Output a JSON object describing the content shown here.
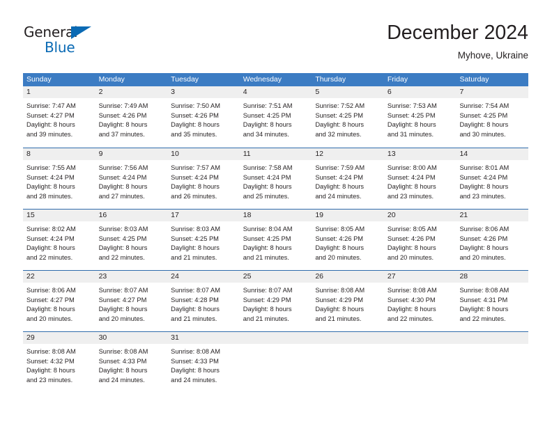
{
  "brand": {
    "name_part1": "General",
    "name_part2": "Blue",
    "triangle_icon": "triangle-icon",
    "color_dark": "#231f20",
    "color_blue": "#0a6ab4"
  },
  "header": {
    "title": "December 2024",
    "subtitle": "Myhove, Ukraine"
  },
  "colors": {
    "header_blue": "#3c7cc3",
    "row_divider_blue": "#2e6bab",
    "day_band_gray": "#efefef",
    "text": "#231f20"
  },
  "calendar": {
    "day_headers": [
      "Sunday",
      "Monday",
      "Tuesday",
      "Wednesday",
      "Thursday",
      "Friday",
      "Saturday"
    ],
    "weeks": [
      [
        {
          "day": "1",
          "sunrise": "Sunrise: 7:47 AM",
          "sunset": "Sunset: 4:27 PM",
          "daylight1": "Daylight: 8 hours",
          "daylight2": "and 39 minutes."
        },
        {
          "day": "2",
          "sunrise": "Sunrise: 7:49 AM",
          "sunset": "Sunset: 4:26 PM",
          "daylight1": "Daylight: 8 hours",
          "daylight2": "and 37 minutes."
        },
        {
          "day": "3",
          "sunrise": "Sunrise: 7:50 AM",
          "sunset": "Sunset: 4:26 PM",
          "daylight1": "Daylight: 8 hours",
          "daylight2": "and 35 minutes."
        },
        {
          "day": "4",
          "sunrise": "Sunrise: 7:51 AM",
          "sunset": "Sunset: 4:25 PM",
          "daylight1": "Daylight: 8 hours",
          "daylight2": "and 34 minutes."
        },
        {
          "day": "5",
          "sunrise": "Sunrise: 7:52 AM",
          "sunset": "Sunset: 4:25 PM",
          "daylight1": "Daylight: 8 hours",
          "daylight2": "and 32 minutes."
        },
        {
          "day": "6",
          "sunrise": "Sunrise: 7:53 AM",
          "sunset": "Sunset: 4:25 PM",
          "daylight1": "Daylight: 8 hours",
          "daylight2": "and 31 minutes."
        },
        {
          "day": "7",
          "sunrise": "Sunrise: 7:54 AM",
          "sunset": "Sunset: 4:25 PM",
          "daylight1": "Daylight: 8 hours",
          "daylight2": "and 30 minutes."
        }
      ],
      [
        {
          "day": "8",
          "sunrise": "Sunrise: 7:55 AM",
          "sunset": "Sunset: 4:24 PM",
          "daylight1": "Daylight: 8 hours",
          "daylight2": "and 28 minutes."
        },
        {
          "day": "9",
          "sunrise": "Sunrise: 7:56 AM",
          "sunset": "Sunset: 4:24 PM",
          "daylight1": "Daylight: 8 hours",
          "daylight2": "and 27 minutes."
        },
        {
          "day": "10",
          "sunrise": "Sunrise: 7:57 AM",
          "sunset": "Sunset: 4:24 PM",
          "daylight1": "Daylight: 8 hours",
          "daylight2": "and 26 minutes."
        },
        {
          "day": "11",
          "sunrise": "Sunrise: 7:58 AM",
          "sunset": "Sunset: 4:24 PM",
          "daylight1": "Daylight: 8 hours",
          "daylight2": "and 25 minutes."
        },
        {
          "day": "12",
          "sunrise": "Sunrise: 7:59 AM",
          "sunset": "Sunset: 4:24 PM",
          "daylight1": "Daylight: 8 hours",
          "daylight2": "and 24 minutes."
        },
        {
          "day": "13",
          "sunrise": "Sunrise: 8:00 AM",
          "sunset": "Sunset: 4:24 PM",
          "daylight1": "Daylight: 8 hours",
          "daylight2": "and 23 minutes."
        },
        {
          "day": "14",
          "sunrise": "Sunrise: 8:01 AM",
          "sunset": "Sunset: 4:24 PM",
          "daylight1": "Daylight: 8 hours",
          "daylight2": "and 23 minutes."
        }
      ],
      [
        {
          "day": "15",
          "sunrise": "Sunrise: 8:02 AM",
          "sunset": "Sunset: 4:24 PM",
          "daylight1": "Daylight: 8 hours",
          "daylight2": "and 22 minutes."
        },
        {
          "day": "16",
          "sunrise": "Sunrise: 8:03 AM",
          "sunset": "Sunset: 4:25 PM",
          "daylight1": "Daylight: 8 hours",
          "daylight2": "and 22 minutes."
        },
        {
          "day": "17",
          "sunrise": "Sunrise: 8:03 AM",
          "sunset": "Sunset: 4:25 PM",
          "daylight1": "Daylight: 8 hours",
          "daylight2": "and 21 minutes."
        },
        {
          "day": "18",
          "sunrise": "Sunrise: 8:04 AM",
          "sunset": "Sunset: 4:25 PM",
          "daylight1": "Daylight: 8 hours",
          "daylight2": "and 21 minutes."
        },
        {
          "day": "19",
          "sunrise": "Sunrise: 8:05 AM",
          "sunset": "Sunset: 4:26 PM",
          "daylight1": "Daylight: 8 hours",
          "daylight2": "and 20 minutes."
        },
        {
          "day": "20",
          "sunrise": "Sunrise: 8:05 AM",
          "sunset": "Sunset: 4:26 PM",
          "daylight1": "Daylight: 8 hours",
          "daylight2": "and 20 minutes."
        },
        {
          "day": "21",
          "sunrise": "Sunrise: 8:06 AM",
          "sunset": "Sunset: 4:26 PM",
          "daylight1": "Daylight: 8 hours",
          "daylight2": "and 20 minutes."
        }
      ],
      [
        {
          "day": "22",
          "sunrise": "Sunrise: 8:06 AM",
          "sunset": "Sunset: 4:27 PM",
          "daylight1": "Daylight: 8 hours",
          "daylight2": "and 20 minutes."
        },
        {
          "day": "23",
          "sunrise": "Sunrise: 8:07 AM",
          "sunset": "Sunset: 4:27 PM",
          "daylight1": "Daylight: 8 hours",
          "daylight2": "and 20 minutes."
        },
        {
          "day": "24",
          "sunrise": "Sunrise: 8:07 AM",
          "sunset": "Sunset: 4:28 PM",
          "daylight1": "Daylight: 8 hours",
          "daylight2": "and 21 minutes."
        },
        {
          "day": "25",
          "sunrise": "Sunrise: 8:07 AM",
          "sunset": "Sunset: 4:29 PM",
          "daylight1": "Daylight: 8 hours",
          "daylight2": "and 21 minutes."
        },
        {
          "day": "26",
          "sunrise": "Sunrise: 8:08 AM",
          "sunset": "Sunset: 4:29 PM",
          "daylight1": "Daylight: 8 hours",
          "daylight2": "and 21 minutes."
        },
        {
          "day": "27",
          "sunrise": "Sunrise: 8:08 AM",
          "sunset": "Sunset: 4:30 PM",
          "daylight1": "Daylight: 8 hours",
          "daylight2": "and 22 minutes."
        },
        {
          "day": "28",
          "sunrise": "Sunrise: 8:08 AM",
          "sunset": "Sunset: 4:31 PM",
          "daylight1": "Daylight: 8 hours",
          "daylight2": "and 22 minutes."
        }
      ],
      [
        {
          "day": "29",
          "sunrise": "Sunrise: 8:08 AM",
          "sunset": "Sunset: 4:32 PM",
          "daylight1": "Daylight: 8 hours",
          "daylight2": "and 23 minutes."
        },
        {
          "day": "30",
          "sunrise": "Sunrise: 8:08 AM",
          "sunset": "Sunset: 4:33 PM",
          "daylight1": "Daylight: 8 hours",
          "daylight2": "and 24 minutes."
        },
        {
          "day": "31",
          "sunrise": "Sunrise: 8:08 AM",
          "sunset": "Sunset: 4:33 PM",
          "daylight1": "Daylight: 8 hours",
          "daylight2": "and 24 minutes."
        },
        {
          "day": "",
          "sunrise": "",
          "sunset": "",
          "daylight1": "",
          "daylight2": ""
        },
        {
          "day": "",
          "sunrise": "",
          "sunset": "",
          "daylight1": "",
          "daylight2": ""
        },
        {
          "day": "",
          "sunrise": "",
          "sunset": "",
          "daylight1": "",
          "daylight2": ""
        },
        {
          "day": "",
          "sunrise": "",
          "sunset": "",
          "daylight1": "",
          "daylight2": ""
        }
      ]
    ]
  }
}
